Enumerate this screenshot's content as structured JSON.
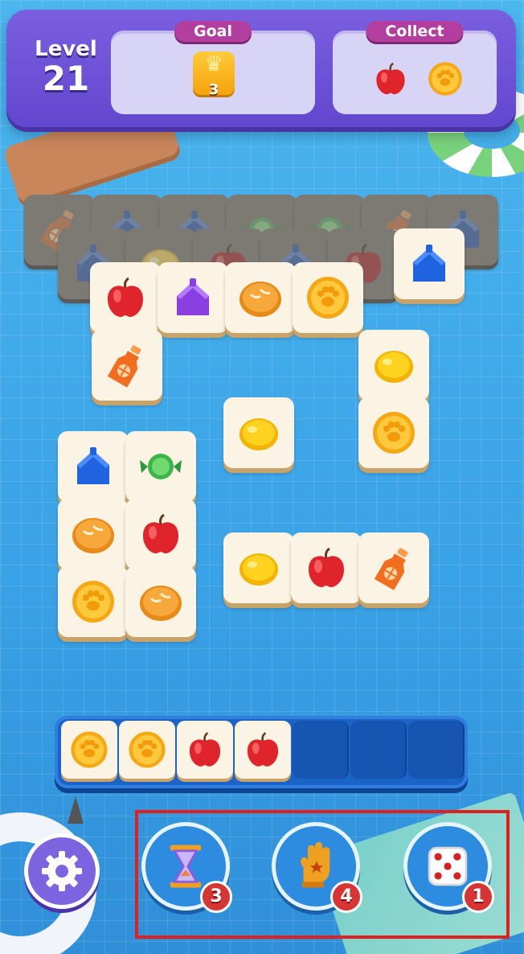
{
  "header": {
    "level_label": "Level",
    "level_number": "21",
    "goal": {
      "title": "Goal",
      "crown_count": "3",
      "icon": "crown-icon"
    },
    "collect": {
      "title": "Collect",
      "icons": [
        "apple-icon",
        "paw-coin-icon"
      ]
    }
  },
  "board": {
    "tiles": [
      {
        "item": "bottle",
        "state": "covered"
      },
      {
        "item": "house",
        "state": "covered"
      },
      {
        "item": "house",
        "state": "covered"
      },
      {
        "item": "candy",
        "state": "covered"
      },
      {
        "item": "candy",
        "state": "covered"
      },
      {
        "item": "bottle",
        "state": "covered"
      },
      {
        "item": "house",
        "state": "covered"
      },
      {
        "item": "house",
        "state": "covered"
      },
      {
        "item": "lemon",
        "state": "covered"
      },
      {
        "item": "apple",
        "state": "covered"
      },
      {
        "item": "house",
        "state": "covered"
      },
      {
        "item": "apple",
        "state": "covered"
      },
      {
        "item": "apple",
        "state": "free"
      },
      {
        "item": "house",
        "state": "free"
      },
      {
        "item": "bread",
        "state": "free"
      },
      {
        "item": "paw-coin",
        "state": "free"
      },
      {
        "item": "house",
        "state": "free"
      },
      {
        "item": "bottle",
        "state": "free"
      },
      {
        "item": "lemon",
        "state": "free"
      },
      {
        "item": "lemon",
        "state": "free"
      },
      {
        "item": "paw-coin",
        "state": "free"
      },
      {
        "item": "house",
        "state": "free"
      },
      {
        "item": "candy",
        "state": "free"
      },
      {
        "item": "bread",
        "state": "free"
      },
      {
        "item": "apple",
        "state": "free"
      },
      {
        "item": "paw-coin",
        "state": "free"
      },
      {
        "item": "bread",
        "state": "free"
      },
      {
        "item": "lemon",
        "state": "free"
      },
      {
        "item": "apple",
        "state": "free"
      },
      {
        "item": "bottle",
        "state": "free"
      }
    ]
  },
  "tray": {
    "capacity": 7,
    "items": [
      "paw-coin",
      "paw-coin",
      "apple",
      "apple"
    ]
  },
  "boosters": [
    {
      "name": "undo",
      "icon": "hourglass-icon",
      "count": "3"
    },
    {
      "name": "grab",
      "icon": "glove-icon",
      "count": "4"
    },
    {
      "name": "shuffle",
      "icon": "dice-icon",
      "count": "1"
    }
  ],
  "settings": {
    "icon": "gear-icon"
  },
  "colors": {
    "header_purple": "#6b4fd8",
    "tag_magenta": "#b23fa0",
    "tray_blue": "#1a64c8",
    "highlight_red": "#e0201f",
    "badge_red": "#d93434"
  }
}
